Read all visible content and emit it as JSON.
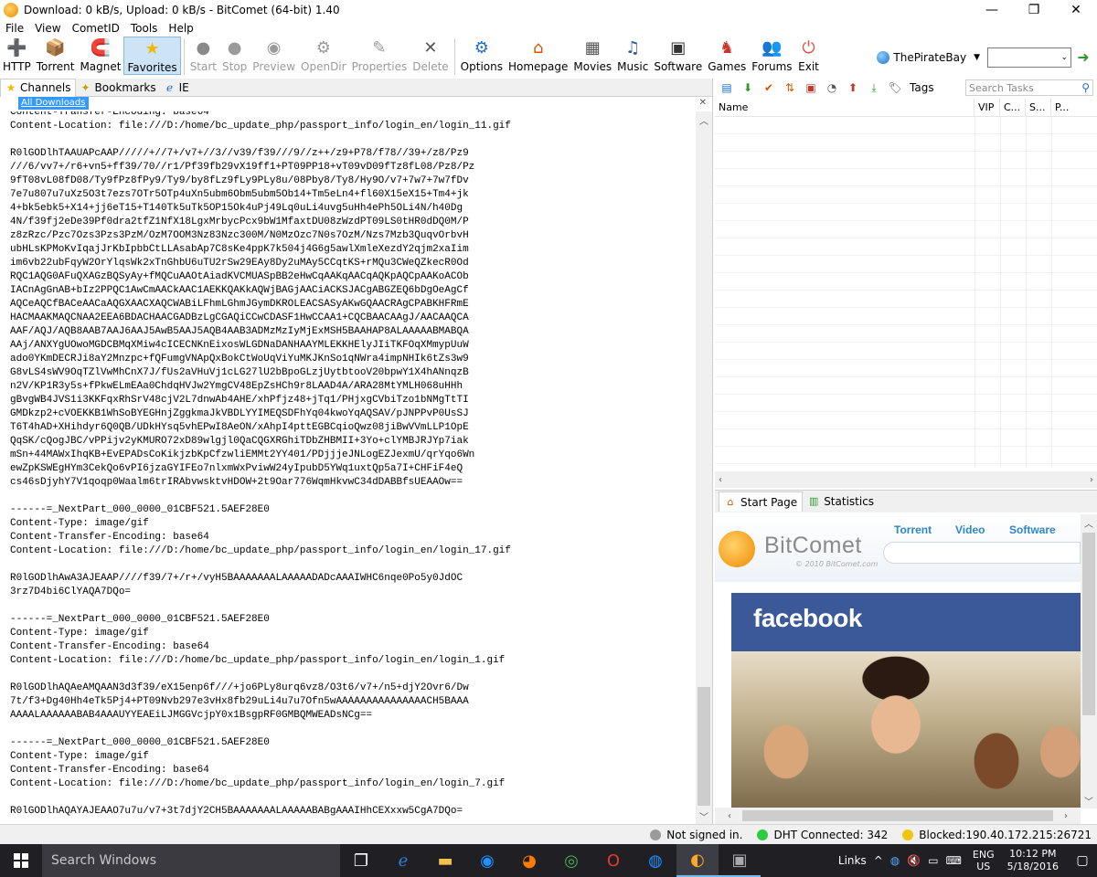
{
  "window": {
    "title": "Download: 0 kB/s, Upload: 0 kB/s - BitComet (64-bit) 1.40",
    "minimize": "—",
    "maximize": "❐",
    "close": "✕"
  },
  "menu": [
    "File",
    "View",
    "CometID",
    "Tools",
    "Help"
  ],
  "toolbar": {
    "buttons": [
      {
        "label": "HTTP",
        "icon": "http-icon",
        "glyph": "➕",
        "color": "#2e9a2e"
      },
      {
        "label": "Torrent",
        "icon": "torrent-icon",
        "glyph": "📦",
        "color": "#c8a000"
      },
      {
        "label": "Magnet",
        "icon": "magnet-icon",
        "glyph": "🧲",
        "color": "#c0392b"
      },
      {
        "label": "Favorites",
        "icon": "star-icon",
        "glyph": "★",
        "color": "#f2b705"
      },
      {
        "label": "Start",
        "icon": "start-icon",
        "glyph": "●",
        "color": "#8a8a8a"
      },
      {
        "label": "Stop",
        "icon": "stop-icon",
        "glyph": "●",
        "color": "#9a9a9a"
      },
      {
        "label": "Preview",
        "icon": "preview-icon",
        "glyph": "◉",
        "color": "#9a9a9a"
      },
      {
        "label": "OpenDir",
        "icon": "opendir-icon",
        "glyph": "⚙",
        "color": "#9a9a9a"
      },
      {
        "label": "Properties",
        "icon": "properties-icon",
        "glyph": "✎",
        "color": "#9a9a9a"
      },
      {
        "label": "Delete",
        "icon": "delete-icon",
        "glyph": "✕",
        "color": "#555555"
      },
      {
        "label": "Options",
        "icon": "options-icon",
        "glyph": "⚙",
        "color": "#1f6fc4"
      },
      {
        "label": "Homepage",
        "icon": "home-icon",
        "glyph": "⌂",
        "color": "#d35400"
      },
      {
        "label": "Movies",
        "icon": "movies-icon",
        "glyph": "▦",
        "color": "#555555"
      },
      {
        "label": "Music",
        "icon": "music-icon",
        "glyph": "♫",
        "color": "#2c5aa0"
      },
      {
        "label": "Software",
        "icon": "software-icon",
        "glyph": "▣",
        "color": "#333333"
      },
      {
        "label": "Games",
        "icon": "games-icon",
        "glyph": "♞",
        "color": "#c0392b"
      },
      {
        "label": "Forums",
        "icon": "forums-icon",
        "glyph": "👥",
        "color": "#8e44ad"
      },
      {
        "label": "Exit",
        "icon": "exit-icon",
        "glyph": "⏻",
        "color": "#e74c3c"
      }
    ],
    "search_engine": "ThePirateBay"
  },
  "left_tabs": [
    "Channels",
    "Bookmarks",
    "IE"
  ],
  "address": "All Downloads",
  "content_lines": [
    "Content-Transfer-Encoding: base64",
    "Content-Location: file:///D:/home/bc_update_php/passport_info/login_en/login_11.gif",
    "",
    "R0lGODlhTAAUAPcAAP/////+//7+/v7+//3//v39/f39///9//z++/z9+P78/f78//39+/z8/Pz9",
    "///6/vv7+/r6+vn5+ff39/70//r1/Pf39fb29vX19ff1+PT09PP18+vT09vD09fTz8fL08/Pz8/Pz",
    "9fT08vL08fD08/Ty9fPz8fPy9/Ty9/by8fLz9fLy9PLy8u/08Pby8/Ty8/Hy9O/v7+7w7+7w7fDv",
    "7e7u807u7uXz5O3t7ezs7OTr5OTp4uXn5ubm6Obm5ubm5Ob14+Tm5eLn4+fl60X15eX15+Tm4+jk",
    "4+bk5ebk5+X14+jj6eT15+T140Tk5uTk5OP15Ok4uPj49Lq0uLi4uvg5uHh4ePh5OLi4N/h40Dg",
    "4N/f39fj2eDe39Pf0dra2tfZ1NfX18LgxMrbycPcx9bW1MfaxtDU08zWzdPT09LS0tHR0dDQ0M/P",
    "z8zRzc/Pzc7Ozs3Pzs3PzM/OzM7OOM3Nz83Nzc300M/N0MzOzc7N0s7OzM/Nzs7Mzb3QuqvOrbvH",
    "ubHLsKPMoKvIqajJrKbIpbbCtLLAsabAp7C8sKe4ppK7k504j4G6g5awlXmleXezdY2qjm2xaIim",
    "im6vb22ubFqyW2OrYlqsWk2xTnGhbU6uTU2rSw29EAy8Dy2uMAy5CCqtKS+rMQu3CWeQZkecR0Od",
    "RQC1AQG0AFuQXAGzBQSyAy+fMQCuAAOtAiadKVCMUASpBB2eHwCqAAKqAACqAQKpAQCpAAKoACOb",
    "IACnAgGnAB+bIz2PPQC1AwCmAACkAAC1AEKKQAKkAQWjBAGjAACiACKSJACgABGZEQ6bDgOeAgCf",
    "AQCeAQCfBACeAACaAQGXAACXAQCWABiLFhmLGhmJGymDKROLEACSASyAKwGQAACRAgCPABKHFRmE",
    "HACMAAKMAQCNAA2EEA6BDACHAACGADBzLgCGAQiCCwCDASF1HwCCAA1+CQCBAACAAgJ/AACAAQCA",
    "AAF/AQJ/AQB8AAB7AAJ6AAJ5AwB5AAJ5AQB4AAB3ADMzMzIyMjExMSH5BAAHAP8ALAAAAABMABQA",
    "AAj/ANXYgUOwoMGDCBMqXMiw4cICECNKnEixosWLGDNaDANHAAYMLEKKHElyJIiTKFOqXMmypUuW",
    "ado0YKmDECRJi8aY2Mnzpc+fQFumgVNApQxBokCtWoUqViYuMKJKnSo1qNWra4impNHIk6tZs3w9",
    "G8vLS4sWV9OqTZlVwMhCnX7J/fUs2aVHuVj1cLG27lU2bBpoGLzjUytbtooV20bpwY1X4hANnqzB",
    "n2V/KP1R3y5s+fPkwELmEAa0ChdqHVJw2YmgCV48EpZsHCh9r8LAAD4A/ARA28MtYMLH068uHHh",
    "gBvgWB4JVS1i3KKFqxRhSrV48cjV2L7dnwAb4AHE/xhPfjz48+jTq1/PHjxgCVbiTzo1bNMgTtTI",
    "GMDkzp2+cVOEKKB1WhSoBYEGHnjZggkmaJkVBDLYYIMEQSDFhYq04kwoYqAQSAV/pJNPPvP0UsSJ",
    "T6T4hAD+XHihdyr6Q0QB/UDkHYsq5vhEPwI8AeON/xAhpI4pttEGBCqioQwz08jiBwVVmLLP1OpE",
    "QqSK/cQogJBC/vPPijv2yKMURO72xD89wlgjl0QaCQGXRGhiTDbZHBMII+3Yo+clYMBJRJYp7iak",
    "mSn+44MAWxIhqKB+EvEPADsCoKikjzbKpCfzwliEMMt2YY401/PDjjjeJNLogEZJexmU/qrYqo6Wn",
    "ewZpKSWEgHYm3CekQo6vPI6jzaGYIFEo7nlxmWxPviwW24yIpubD5YWq1uxtQp5a7I+CHFiF4eQ",
    "cs46sDjyhY7V1qoqp0Waalm6trIRAbvwsktvHDOW+2t9Oar776WqmHkvwC34dDABBfsUEAAOw==",
    "",
    "------=_NextPart_000_0000_01CBF521.5AEF28E0",
    "Content-Type: image/gif",
    "Content-Transfer-Encoding: base64",
    "Content-Location: file:///D:/home/bc_update_php/passport_info/login_en/login_17.gif",
    "",
    "R0lGODlhAwA3AJEAAP////f39/7+/r+/vyH5BAAAAAAALAAAAADADcAAAIWHC6nqe0Po5y0JdOC",
    "3rz7D4bi6ClYAQA7DQo=",
    "",
    "------=_NextPart_000_0000_01CBF521.5AEF28E0",
    "Content-Type: image/gif",
    "Content-Transfer-Encoding: base64",
    "Content-Location: file:///D:/home/bc_update_php/passport_info/login_en/login_1.gif",
    "",
    "R0lGODlhAQAeAMQAAN3d3f39/eX15enp6f///+jo6PLy8urq6vz8/O3t6/v7+/n5+djY2Ovr6/Dw",
    "7t/f3+Dg40Hh4eTk5Pj4+PT09Nvb297e3vHx8fb29uLi4u7u7Ofn5wAAAAAAAAAAAAAAACH5BAAA",
    "AAAALAAAAAABAB4AAAUYYEAEiLJMGGVcjpY0x1BsgpRF0GMBQMWEADsNCg==",
    "",
    "------=_NextPart_000_0000_01CBF521.5AEF28E0",
    "Content-Type: image/gif",
    "Content-Transfer-Encoding: base64",
    "Content-Location: file:///D:/home/bc_update_php/passport_info/login_en/login_7.gif",
    "",
    "R0lGODlhAQAYAJEAAO7u7u/v7+3t7djY2CH5BAAAAAAALAAAAABABgAAAIHhCEXxxw5CgA7DQo="
  ],
  "tasks": {
    "search_placeholder": "Search Tasks",
    "tags_label": "Tags",
    "columns": [
      "Name",
      "VIP",
      "C...",
      "S...",
      "P..."
    ]
  },
  "bottom_tabs": [
    "Start Page",
    "Statistics"
  ],
  "start_page": {
    "brand": "BitComet",
    "copyright": "© 2010 BitComet.com",
    "nav": [
      "Torrent",
      "Video",
      "Software"
    ],
    "banner": "facebook"
  },
  "status": {
    "signin": "Not signed in.",
    "dht": "DHT Connected: 342",
    "blocked": "Blocked:190.40.172.215:26721",
    "colors": {
      "signin": "#9a9a9a",
      "dht": "#2ecc40",
      "blocked": "#f1c40f"
    }
  },
  "taskbar": {
    "search_placeholder": "Search Windows",
    "links": "Links",
    "lang_top": "ENG",
    "lang_bottom": "US",
    "time": "10:12 PM",
    "date": "5/18/2016"
  }
}
